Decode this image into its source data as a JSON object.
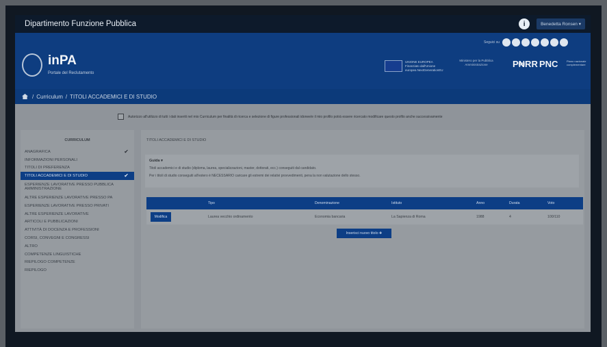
{
  "topbar": {
    "title": "Dipartimento Funzione Pubblica",
    "info_label": "i",
    "user_label": "Benedetta Ronsen ▾"
  },
  "header": {
    "logo_title": "inPA",
    "logo_subtitle": "Portale del Reclutamento",
    "seguici": "Seguici su",
    "eu_text": "UNIONE EUROPEA Finanziato dall'Unione europea NextGenerationEU",
    "gov_text": "Ministero per la Pubblica Amministrazione",
    "pnrr": "P₦RR",
    "pnc": "PNC",
    "pnc_sub": "Piano nazionale complementare"
  },
  "breadcrumb": {
    "items": [
      "Curriculum",
      "TITOLI ACCADEMICI E DI STUDIO"
    ],
    "separator": "/"
  },
  "consent_text": "Autorizzo all'utilizzo di tutti i dati inseriti nel mio Curriculum per finalità di ricerca e selezione di figure professionali idonee/e il mio profilo potrà essere ricercato modificare questo profilo anche successivamente",
  "sidebar": {
    "title": "CURRICULUM",
    "items": [
      {
        "label": "ANAGRAFICA",
        "done": true
      },
      {
        "label": "INFORMAZIONI PERSONALI",
        "done": false
      },
      {
        "label": "TITOLI DI PREFERENZA",
        "done": false
      },
      {
        "label": "TITOLI ACCADEMICI E DI STUDIO",
        "done": true,
        "active": true
      },
      {
        "label": "ESPERIENZE LAVORATIVE PRESSO PUBBLICA AMMINISTRAZIONE",
        "done": false
      },
      {
        "label": "ALTRE ESPERIENZE LAVORATIVE PRESSO PA",
        "done": false
      },
      {
        "label": "ESPERIENZE LAVORATIVE PRESSO PRIVATI",
        "done": false
      },
      {
        "label": "ALTRE ESPERIENZE LAVORATIVE",
        "done": false
      },
      {
        "label": "ARTICOLI E PUBBLICAZIONI",
        "done": false
      },
      {
        "label": "ATTIVITÀ DI DOCENZA E PROFESSIONI",
        "done": false
      },
      {
        "label": "CORSI, CONVEGNI E CONGRESSI",
        "done": false
      },
      {
        "label": "ALTRO",
        "done": false
      },
      {
        "label": "COMPETENZE LINGUISTICHE",
        "done": false
      },
      {
        "label": "RIEPILOGO COMPETENZE",
        "done": false
      },
      {
        "label": "RIEPILOGO",
        "done": false
      }
    ]
  },
  "main": {
    "title": "TITOLI ACCADEMICI E DI STUDIO",
    "guida_title": "Guida ▾",
    "guida_line1": "Titoli accademici e di studio (diploma, laurea, specializzazioni, master, dottorati, ecc.) conseguiti dal candidato.",
    "guida_line2": "Per i titoli di studio conseguiti all'estero è NECESSARIO caricare gli estremi dei relativi provvedimenti, pena la non valutazione dello stesso.",
    "table": {
      "headers": [
        "Tipo",
        "Denominazione",
        "Istituto",
        "Anno",
        "Durata",
        "Voto"
      ],
      "rows": [
        {
          "action": "Modifica",
          "tipo": "Laurea vecchio ordinamento",
          "denominazione": "Economia bancaria",
          "istituto": "La Sapienza di Roma",
          "anno": "1988",
          "durata": "4",
          "voto": "100/110"
        }
      ]
    },
    "add_button": "Inserisci nuovo titolo ✚"
  }
}
